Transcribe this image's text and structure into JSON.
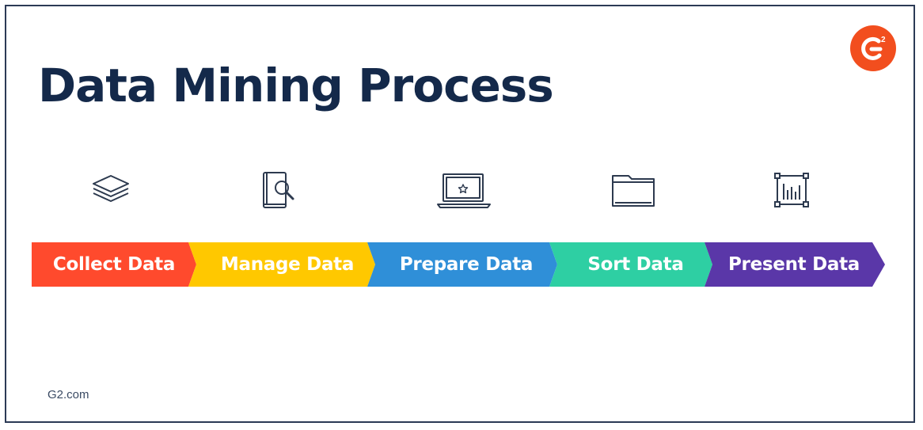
{
  "diagram": {
    "title": "Data Mining Process",
    "footer": "G2.com",
    "logo_icon": "g2-logo-icon",
    "steps": [
      {
        "label": "Collect Data",
        "icon": "layers-icon",
        "color": "#ff4a2d"
      },
      {
        "label": "Manage Data",
        "icon": "book-search-icon",
        "color": "#ffc800"
      },
      {
        "label": "Prepare Data",
        "icon": "laptop-icon",
        "color": "#2f8fd8"
      },
      {
        "label": "Sort Data",
        "icon": "folder-icon",
        "color": "#2ecfa3"
      },
      {
        "label": "Present Data",
        "icon": "chart-frame-icon",
        "color": "#5a37a8"
      }
    ]
  }
}
